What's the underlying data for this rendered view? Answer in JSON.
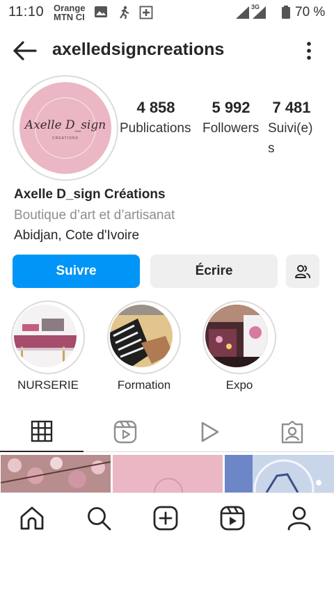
{
  "status_bar": {
    "time": "11:10",
    "carrier_line1": "Orange",
    "carrier_line2": "MTN CI",
    "network": "3G",
    "battery": "70 %"
  },
  "header": {
    "username": "axelledsigncreations"
  },
  "profile": {
    "avatar_text": "Axelle D_sign",
    "avatar_subtext": "CREATIONS",
    "stats": [
      {
        "value": "4 858",
        "label": "Publications"
      },
      {
        "value": "5 992",
        "label": "Followers"
      },
      {
        "value": "7 481",
        "label": "Suivi(e)s"
      }
    ],
    "name": "Axelle D_sign Créations",
    "category": "Boutique d’art et d’artisanat",
    "location": "Abidjan, Cote d'Ivoire"
  },
  "actions": {
    "follow_label": "Suivre",
    "message_label": "Écrire"
  },
  "highlights": [
    {
      "label": "NURSERIE"
    },
    {
      "label": "Formation"
    },
    {
      "label": "Expo"
    }
  ],
  "tabs": [
    "grid-icon",
    "reels-icon",
    "video-play-icon",
    "tagged-icon"
  ],
  "nav": [
    "home-icon",
    "search-icon",
    "create-icon",
    "reels-icon",
    "profile-icon"
  ],
  "colors": {
    "primary": "#0095f6",
    "secondary_button": "#efefef",
    "avatar_pink": "#ebb7c4"
  }
}
